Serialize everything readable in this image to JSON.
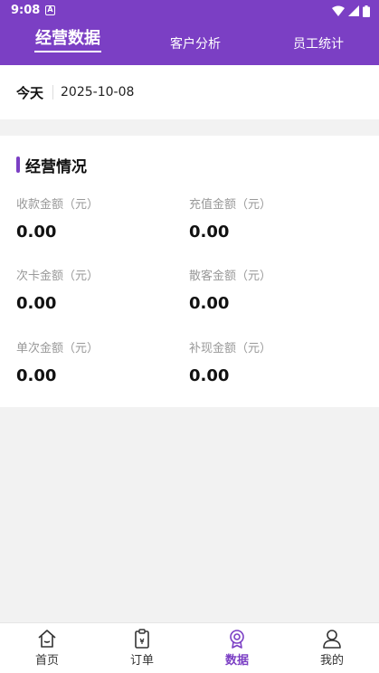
{
  "status_bar": {
    "time": "9:08",
    "notification_glyph": "A"
  },
  "header": {
    "tabs": [
      {
        "label": "经营数据",
        "active": true
      },
      {
        "label": "客户分析",
        "active": false
      },
      {
        "label": "员工统计",
        "active": false
      }
    ]
  },
  "date_filter": {
    "period": "今天",
    "date": "2025-10-08"
  },
  "business_card": {
    "title": "经营情况",
    "metrics": [
      {
        "label": "收款金额（元）",
        "value": "0.00"
      },
      {
        "label": "充值金额（元）",
        "value": "0.00"
      },
      {
        "label": "次卡金额（元）",
        "value": "0.00"
      },
      {
        "label": "散客金额（元）",
        "value": "0.00"
      },
      {
        "label": "单次金额（元）",
        "value": "0.00"
      },
      {
        "label": "补现金额（元）",
        "value": "0.00"
      }
    ]
  },
  "bottom_nav": {
    "items": [
      {
        "label": "首页",
        "icon": "home-icon",
        "active": false
      },
      {
        "label": "订单",
        "icon": "clipboard-icon",
        "active": false
      },
      {
        "label": "数据",
        "icon": "badge-icon",
        "active": true
      },
      {
        "label": "我的",
        "icon": "user-icon",
        "active": false
      }
    ]
  },
  "colors": {
    "accent": "#7b3fc4",
    "background": "#f2f2f2",
    "label_gray": "#999999"
  }
}
